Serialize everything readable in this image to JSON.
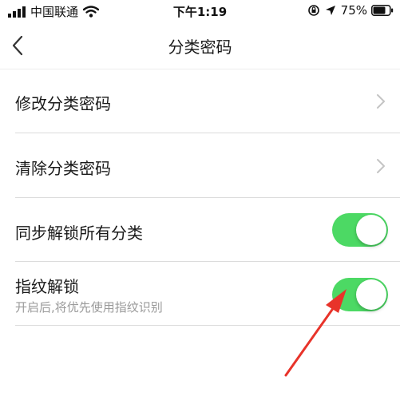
{
  "status_bar": {
    "carrier": "中国联通",
    "time": "下午1:19",
    "battery_percent": "75%"
  },
  "nav": {
    "title": "分类密码"
  },
  "rows": {
    "change_password": {
      "label": "修改分类密码"
    },
    "clear_password": {
      "label": "清除分类密码"
    },
    "sync_unlock": {
      "label": "同步解锁所有分类",
      "enabled": true
    },
    "fingerprint_unlock": {
      "label": "指纹解锁",
      "sublabel": "开启后,将优先使用指纹识别",
      "enabled": true
    }
  },
  "colors": {
    "toggle_on": "#4cd964",
    "annotation_arrow": "#e8332a"
  }
}
